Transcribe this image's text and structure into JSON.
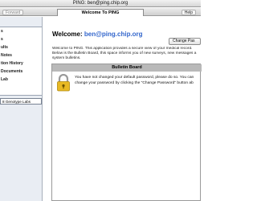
{
  "window": {
    "title": "PING: ben@ping.chip.org"
  },
  "toolbar": {
    "forward_label": "Forward",
    "tab_label": "Welcome To PING",
    "help_label": "Help"
  },
  "sidebar": {
    "items": [
      {
        "label": "s"
      },
      {
        "label": "s"
      },
      {
        "label": "ults"
      },
      {
        "label": "Notes"
      },
      {
        "label": "tion History"
      },
      {
        "label": "Documents"
      },
      {
        "label": "Lab"
      }
    ],
    "selected_source": "8 Genotype Labs"
  },
  "main": {
    "welcome_prefix": "Welcome: ",
    "welcome_email": "ben@ping.chip.org",
    "change_password_label": "Change Pas",
    "intro_line1": "Welcome to PING. This application provides a secure view of your medical record.",
    "intro_line2": "Below is the Bulletin Board, this space informs you of new surveys, new messages a",
    "intro_line3": "system bulletins."
  },
  "bulletin": {
    "title": "Bulletin Board",
    "message_line1": "You have not changed your default password, please do so. You can",
    "message_line2": "change your password by clicking the \"Change Password\" button ab",
    "lock_icon": "lock-icon"
  },
  "colors": {
    "accent_email": "#3366cc",
    "board_header": "#b9b9b9",
    "sidebar_bg": "#e9edf3",
    "lock_gold": "#e8b923"
  }
}
